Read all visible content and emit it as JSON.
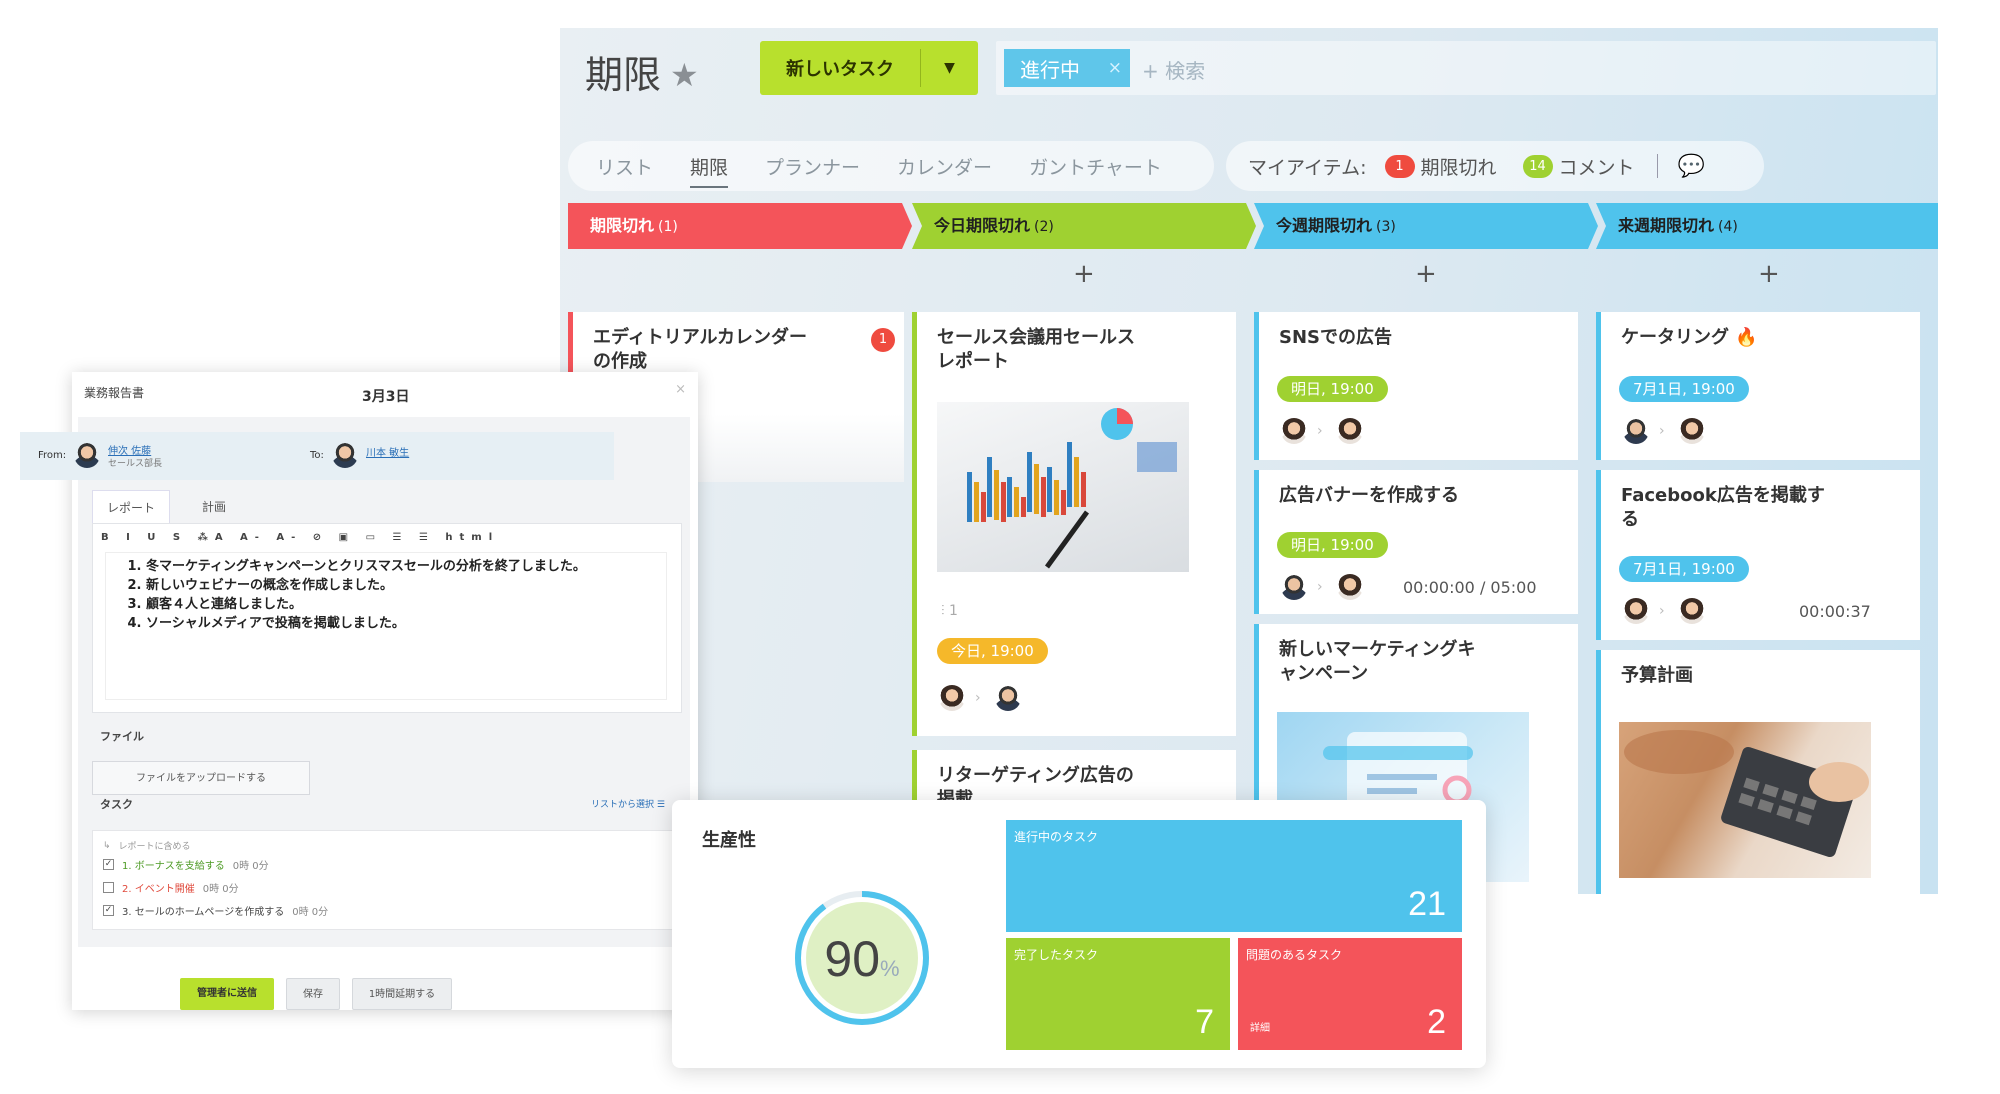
{
  "board": {
    "title": "期限",
    "new_task_label": "新しいタスク",
    "filter_chip": "進行中",
    "search_placeholder": "+ 検索",
    "view_tabs": [
      "リスト",
      "期限",
      "プランナー",
      "カレンダー",
      "ガントチャート"
    ],
    "active_tab": "期限",
    "my_items": {
      "label": "マイアイテム:",
      "overdue_count": "1",
      "overdue_label": "期限切れ",
      "comment_count": "14",
      "comment_label": "コメント"
    },
    "columns": [
      {
        "title": "期限切れ",
        "count": "(1)",
        "color": "#f4545a"
      },
      {
        "title": "今日期限切れ",
        "count": "(2)",
        "color": "#9fd131"
      },
      {
        "title": "今週期限切れ",
        "count": "(3)",
        "color": "#4fc3ec"
      },
      {
        "title": "来週期限切れ",
        "count": "(4)",
        "color": "#4fc3ec"
      }
    ],
    "add_symbol": "+",
    "cards": {
      "c1": {
        "title_l1": "エディトリアルカレンダー",
        "title_l2": "の作成",
        "badge": "1"
      },
      "c2": {
        "title_l1": "セールス会議用セールス",
        "title_l2": "レポート",
        "attach": "⫶ 1",
        "due": "今日, 19:00"
      },
      "c3": {
        "title_l1": "リターゲティング広告の",
        "title_l2": "掲載"
      },
      "c4": {
        "title_l1": "SNSでの広告",
        "due": "明日, 19:00"
      },
      "c5": {
        "title_l1": "広告バナーを作成する",
        "due": "明日, 19:00",
        "timer": "00:00:00 / 05:00"
      },
      "c6": {
        "title_l1": "新しいマーケティングキ",
        "title_l2": "ャンペーン"
      },
      "c7": {
        "title_l1": "ケータリング",
        "due": "7月1日, 19:00"
      },
      "c8": {
        "title_l1": "Facebook広告を掲載す",
        "title_l2": "る",
        "due": "7月1日, 19:00",
        "timer": "00:00:37"
      },
      "c9": {
        "title_l1": "予算計画"
      }
    }
  },
  "report": {
    "title": "業務報告書",
    "date": "3月3日",
    "close": "×",
    "from_label": "From:",
    "from_name": "伸次 佐藤",
    "from_role": "セールス部長",
    "to_label": "To:",
    "to_name": "川本 敏生",
    "tabs": [
      "レポート",
      "計画"
    ],
    "toolbar": "B I U S ⁂A A- A- ⊘ ▣ ▭ ☰ ☰ html",
    "body": [
      "冬マーケティングキャンペーンとクリスマスセールの分析を終了しました。",
      "新しいウェビナーの概念を作成しました。",
      "顧客４人と連絡しました。",
      "ソーシャルメディアで投稿を掲載しました。"
    ],
    "files_label": "ファイル",
    "upload_label": "ファイルをアップロードする",
    "tasks_label": "タスク",
    "list_select": "リストから選択",
    "include_label": "レポートに含める",
    "tasks": [
      {
        "text": "1. ボーナスを支給する",
        "time": "0時 0分",
        "checked": true
      },
      {
        "text": "2. イベント開催",
        "time": "0時 0分",
        "checked": false
      },
      {
        "text": "3. セールのホームページを作成する",
        "time": "0時 0分",
        "checked": true
      }
    ],
    "send_label": "管理者に送信",
    "save_label": "保存",
    "postpone_label": "1時間延期する"
  },
  "productivity": {
    "title": "生産性",
    "percent": "90",
    "percent_sign": "%",
    "percent_value": 0.9,
    "tiles": [
      {
        "label": "進行中のタスク",
        "value": "21",
        "color": "#4fc3ec"
      },
      {
        "label": "完了したタスク",
        "value": "7",
        "color": "#9fd131"
      },
      {
        "label": "問題のあるタスク",
        "value": "2",
        "sub": "詳細",
        "color": "#f4545a"
      }
    ]
  }
}
